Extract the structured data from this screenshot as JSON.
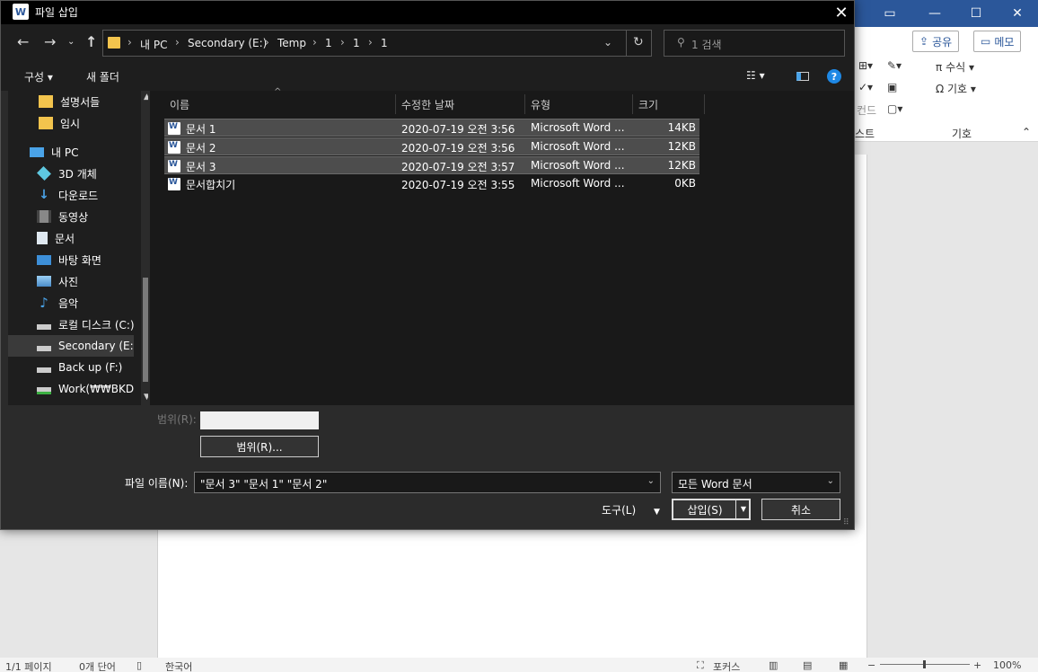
{
  "word": {
    "share_label": "공유",
    "memo_label": "메모",
    "ribbon": {
      "equation": "수식",
      "symbol": "기호",
      "group_symbol": "기호",
      "group_text_partial": "스트",
      "partial_left": "컨드"
    },
    "status": {
      "page": "1/1 페이지",
      "words": "0개 단어",
      "language": "한국어",
      "focus": "포커스",
      "zoom": "100%"
    }
  },
  "dialog": {
    "title": "파일 삽입",
    "address": {
      "crumbs": [
        "내 PC",
        "Secondary (E:)",
        "Temp",
        "1",
        "1",
        "1"
      ]
    },
    "search_placeholder": "1 검색",
    "toolbar": {
      "organize": "구성",
      "new_folder": "새 폴더"
    },
    "nav_items": [
      {
        "label": "설명서들",
        "icon": "folder-icon"
      },
      {
        "label": "임시",
        "icon": "folder-icon"
      },
      {
        "label": "내 PC",
        "icon": "pc-icon"
      },
      {
        "label": "3D 개체",
        "icon": "3d-objects-icon"
      },
      {
        "label": "다운로드",
        "icon": "download-icon"
      },
      {
        "label": "동영상",
        "icon": "video-icon"
      },
      {
        "label": "문서",
        "icon": "document-icon"
      },
      {
        "label": "바탕 화면",
        "icon": "desktop-icon"
      },
      {
        "label": "사진",
        "icon": "pictures-icon"
      },
      {
        "label": "음악",
        "icon": "music-icon"
      },
      {
        "label": "로컬 디스크 (C:)",
        "icon": "drive-icon"
      },
      {
        "label": "Secondary (E:)",
        "icon": "drive-icon"
      },
      {
        "label": "Back up (F:)",
        "icon": "drive-icon"
      },
      {
        "label": "Work(₩₩BKDISK",
        "icon": "network-drive-icon"
      }
    ],
    "columns": {
      "name": "이름",
      "modified": "수정한 날짜",
      "type": "유형",
      "size": "크기"
    },
    "files": [
      {
        "name": "문서 1",
        "modified": "2020-07-19 오전 3:56",
        "type": "Microsoft Word ...",
        "size": "14KB",
        "selected": true
      },
      {
        "name": "문서 2",
        "modified": "2020-07-19 오전 3:56",
        "type": "Microsoft Word ...",
        "size": "12KB",
        "selected": true
      },
      {
        "name": "문서 3",
        "modified": "2020-07-19 오전 3:57",
        "type": "Microsoft Word ...",
        "size": "12KB",
        "selected": true
      },
      {
        "name": "문서합치기",
        "modified": "2020-07-19 오전 3:55",
        "type": "Microsoft Word ...",
        "size": "0KB",
        "selected": false
      }
    ],
    "range_label": "범위(R):",
    "range_button": "범위(R)...",
    "filename_label": "파일 이름(N):",
    "filename_value": "\"문서 3\" \"문서 1\" \"문서 2\"",
    "filetype_value": "모든 Word 문서",
    "tools_label": "도구(L)",
    "insert_button": "삽입(S)",
    "cancel_button": "취소"
  }
}
